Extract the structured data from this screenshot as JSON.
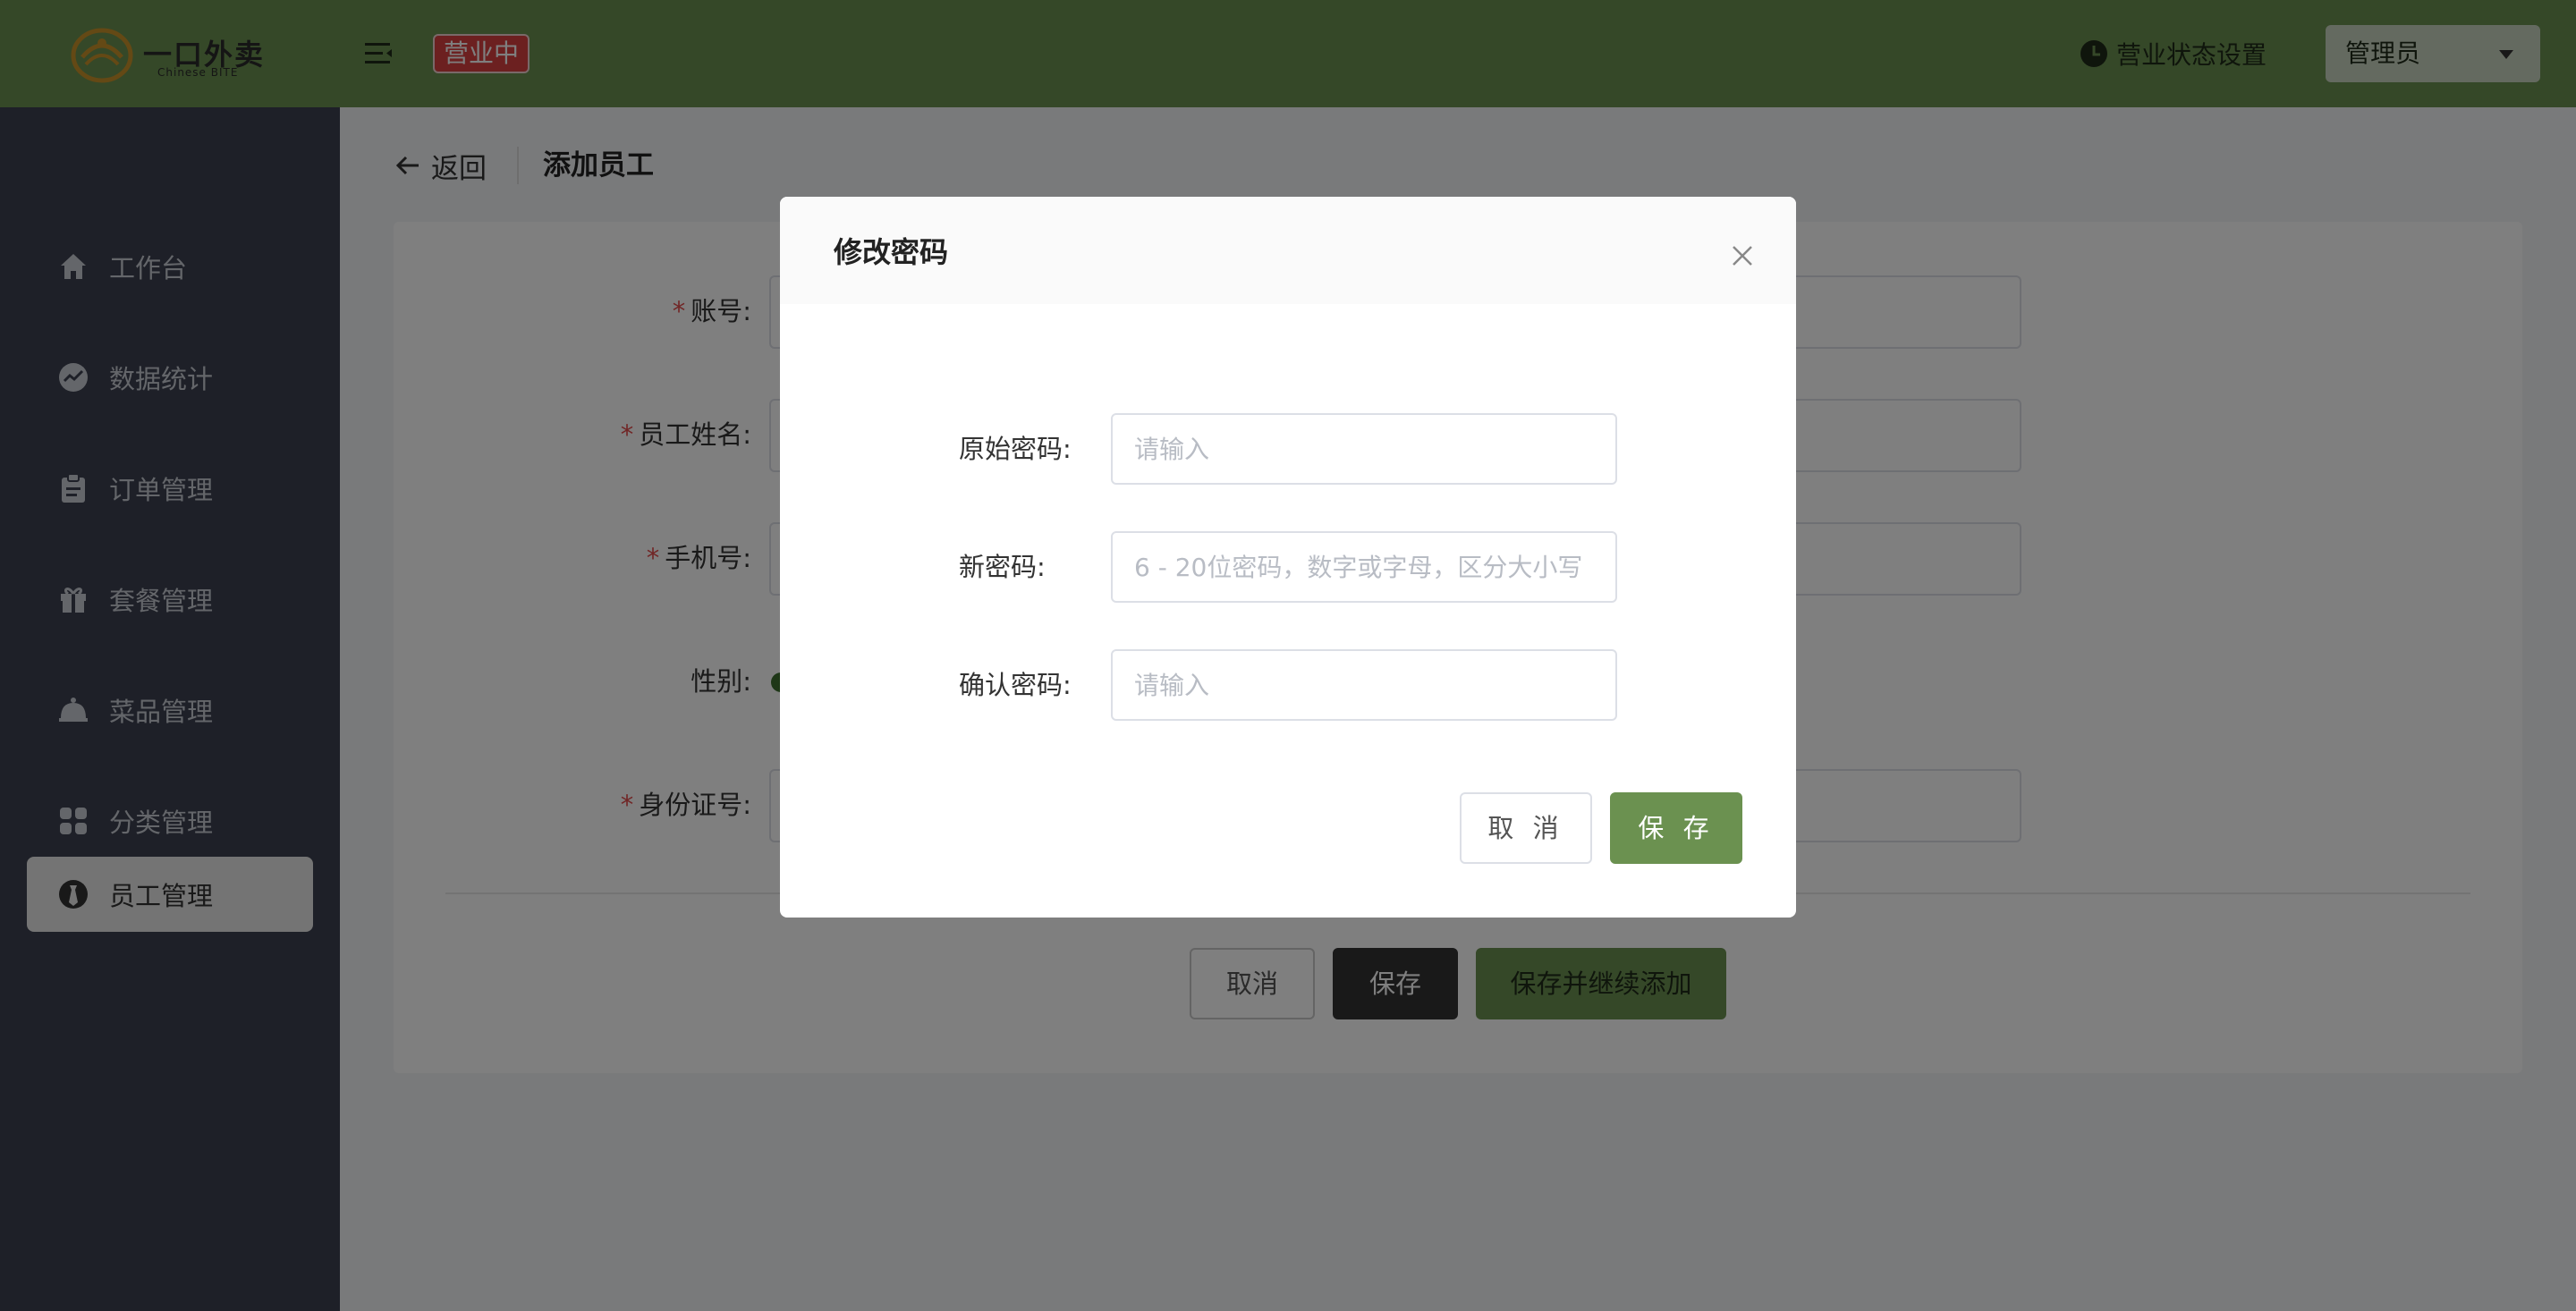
{
  "header": {
    "logo_text": "一口外卖",
    "logo_sub": "Chinese BITE",
    "status_badge": "营业中",
    "biz_setting_label": "营业状态设置",
    "user_label": "管理员"
  },
  "sidebar": {
    "items": [
      {
        "label": "工作台",
        "icon": "home-icon"
      },
      {
        "label": "数据统计",
        "icon": "chart-icon"
      },
      {
        "label": "订单管理",
        "icon": "clipboard-icon"
      },
      {
        "label": "套餐管理",
        "icon": "gift-icon"
      },
      {
        "label": "菜品管理",
        "icon": "dish-cover-icon"
      },
      {
        "label": "分类管理",
        "icon": "grid-icon"
      },
      {
        "label": "员工管理",
        "icon": "employee-icon",
        "active": true
      }
    ]
  },
  "page": {
    "back_label": "返回",
    "title": "添加员工",
    "form": {
      "account_label": "账号:",
      "name_label": "员工姓名:",
      "phone_label": "手机号:",
      "gender_label": "性别:",
      "id_label": "身份证号:",
      "required_mark": "*"
    },
    "buttons": {
      "cancel": "取消",
      "save": "保存",
      "save_continue": "保存并继续添加"
    }
  },
  "modal": {
    "title": "修改密码",
    "fields": {
      "old_label": "原始密码:",
      "old_placeholder": "请输入",
      "new_label": "新密码:",
      "new_placeholder": "6 - 20位密码，数字或字母，区分大小写",
      "confirm_label": "确认密码:",
      "confirm_placeholder": "请输入"
    },
    "cancel_label": "取 消",
    "save_label": "保 存"
  },
  "colors": {
    "brand_green": "#6b9150",
    "sidebar_bg": "#3c4150",
    "status_red": "#d84040",
    "required_red": "#e24c4c"
  }
}
